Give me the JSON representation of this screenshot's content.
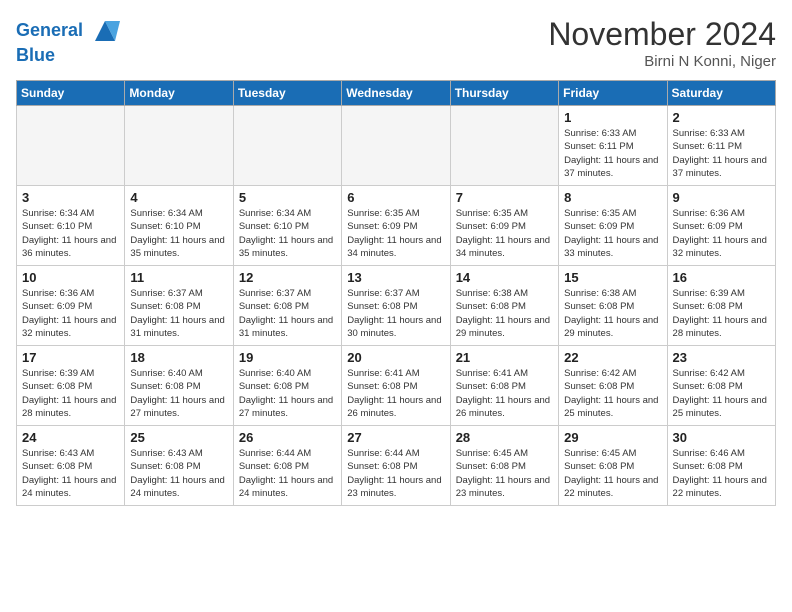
{
  "header": {
    "logo_line1": "General",
    "logo_line2": "Blue",
    "month": "November 2024",
    "location": "Birni N Konni, Niger"
  },
  "weekdays": [
    "Sunday",
    "Monday",
    "Tuesday",
    "Wednesday",
    "Thursday",
    "Friday",
    "Saturday"
  ],
  "weeks": [
    [
      {
        "day": "",
        "empty": true
      },
      {
        "day": "",
        "empty": true
      },
      {
        "day": "",
        "empty": true
      },
      {
        "day": "",
        "empty": true
      },
      {
        "day": "",
        "empty": true
      },
      {
        "day": "1",
        "sunrise": "Sunrise: 6:33 AM",
        "sunset": "Sunset: 6:11 PM",
        "daylight": "Daylight: 11 hours and 37 minutes."
      },
      {
        "day": "2",
        "sunrise": "Sunrise: 6:33 AM",
        "sunset": "Sunset: 6:11 PM",
        "daylight": "Daylight: 11 hours and 37 minutes."
      }
    ],
    [
      {
        "day": "3",
        "sunrise": "Sunrise: 6:34 AM",
        "sunset": "Sunset: 6:10 PM",
        "daylight": "Daylight: 11 hours and 36 minutes."
      },
      {
        "day": "4",
        "sunrise": "Sunrise: 6:34 AM",
        "sunset": "Sunset: 6:10 PM",
        "daylight": "Daylight: 11 hours and 35 minutes."
      },
      {
        "day": "5",
        "sunrise": "Sunrise: 6:34 AM",
        "sunset": "Sunset: 6:10 PM",
        "daylight": "Daylight: 11 hours and 35 minutes."
      },
      {
        "day": "6",
        "sunrise": "Sunrise: 6:35 AM",
        "sunset": "Sunset: 6:09 PM",
        "daylight": "Daylight: 11 hours and 34 minutes."
      },
      {
        "day": "7",
        "sunrise": "Sunrise: 6:35 AM",
        "sunset": "Sunset: 6:09 PM",
        "daylight": "Daylight: 11 hours and 34 minutes."
      },
      {
        "day": "8",
        "sunrise": "Sunrise: 6:35 AM",
        "sunset": "Sunset: 6:09 PM",
        "daylight": "Daylight: 11 hours and 33 minutes."
      },
      {
        "day": "9",
        "sunrise": "Sunrise: 6:36 AM",
        "sunset": "Sunset: 6:09 PM",
        "daylight": "Daylight: 11 hours and 32 minutes."
      }
    ],
    [
      {
        "day": "10",
        "sunrise": "Sunrise: 6:36 AM",
        "sunset": "Sunset: 6:09 PM",
        "daylight": "Daylight: 11 hours and 32 minutes."
      },
      {
        "day": "11",
        "sunrise": "Sunrise: 6:37 AM",
        "sunset": "Sunset: 6:08 PM",
        "daylight": "Daylight: 11 hours and 31 minutes."
      },
      {
        "day": "12",
        "sunrise": "Sunrise: 6:37 AM",
        "sunset": "Sunset: 6:08 PM",
        "daylight": "Daylight: 11 hours and 31 minutes."
      },
      {
        "day": "13",
        "sunrise": "Sunrise: 6:37 AM",
        "sunset": "Sunset: 6:08 PM",
        "daylight": "Daylight: 11 hours and 30 minutes."
      },
      {
        "day": "14",
        "sunrise": "Sunrise: 6:38 AM",
        "sunset": "Sunset: 6:08 PM",
        "daylight": "Daylight: 11 hours and 29 minutes."
      },
      {
        "day": "15",
        "sunrise": "Sunrise: 6:38 AM",
        "sunset": "Sunset: 6:08 PM",
        "daylight": "Daylight: 11 hours and 29 minutes."
      },
      {
        "day": "16",
        "sunrise": "Sunrise: 6:39 AM",
        "sunset": "Sunset: 6:08 PM",
        "daylight": "Daylight: 11 hours and 28 minutes."
      }
    ],
    [
      {
        "day": "17",
        "sunrise": "Sunrise: 6:39 AM",
        "sunset": "Sunset: 6:08 PM",
        "daylight": "Daylight: 11 hours and 28 minutes."
      },
      {
        "day": "18",
        "sunrise": "Sunrise: 6:40 AM",
        "sunset": "Sunset: 6:08 PM",
        "daylight": "Daylight: 11 hours and 27 minutes."
      },
      {
        "day": "19",
        "sunrise": "Sunrise: 6:40 AM",
        "sunset": "Sunset: 6:08 PM",
        "daylight": "Daylight: 11 hours and 27 minutes."
      },
      {
        "day": "20",
        "sunrise": "Sunrise: 6:41 AM",
        "sunset": "Sunset: 6:08 PM",
        "daylight": "Daylight: 11 hours and 26 minutes."
      },
      {
        "day": "21",
        "sunrise": "Sunrise: 6:41 AM",
        "sunset": "Sunset: 6:08 PM",
        "daylight": "Daylight: 11 hours and 26 minutes."
      },
      {
        "day": "22",
        "sunrise": "Sunrise: 6:42 AM",
        "sunset": "Sunset: 6:08 PM",
        "daylight": "Daylight: 11 hours and 25 minutes."
      },
      {
        "day": "23",
        "sunrise": "Sunrise: 6:42 AM",
        "sunset": "Sunset: 6:08 PM",
        "daylight": "Daylight: 11 hours and 25 minutes."
      }
    ],
    [
      {
        "day": "24",
        "sunrise": "Sunrise: 6:43 AM",
        "sunset": "Sunset: 6:08 PM",
        "daylight": "Daylight: 11 hours and 24 minutes."
      },
      {
        "day": "25",
        "sunrise": "Sunrise: 6:43 AM",
        "sunset": "Sunset: 6:08 PM",
        "daylight": "Daylight: 11 hours and 24 minutes."
      },
      {
        "day": "26",
        "sunrise": "Sunrise: 6:44 AM",
        "sunset": "Sunset: 6:08 PM",
        "daylight": "Daylight: 11 hours and 24 minutes."
      },
      {
        "day": "27",
        "sunrise": "Sunrise: 6:44 AM",
        "sunset": "Sunset: 6:08 PM",
        "daylight": "Daylight: 11 hours and 23 minutes."
      },
      {
        "day": "28",
        "sunrise": "Sunrise: 6:45 AM",
        "sunset": "Sunset: 6:08 PM",
        "daylight": "Daylight: 11 hours and 23 minutes."
      },
      {
        "day": "29",
        "sunrise": "Sunrise: 6:45 AM",
        "sunset": "Sunset: 6:08 PM",
        "daylight": "Daylight: 11 hours and 22 minutes."
      },
      {
        "day": "30",
        "sunrise": "Sunrise: 6:46 AM",
        "sunset": "Sunset: 6:08 PM",
        "daylight": "Daylight: 11 hours and 22 minutes."
      }
    ]
  ]
}
